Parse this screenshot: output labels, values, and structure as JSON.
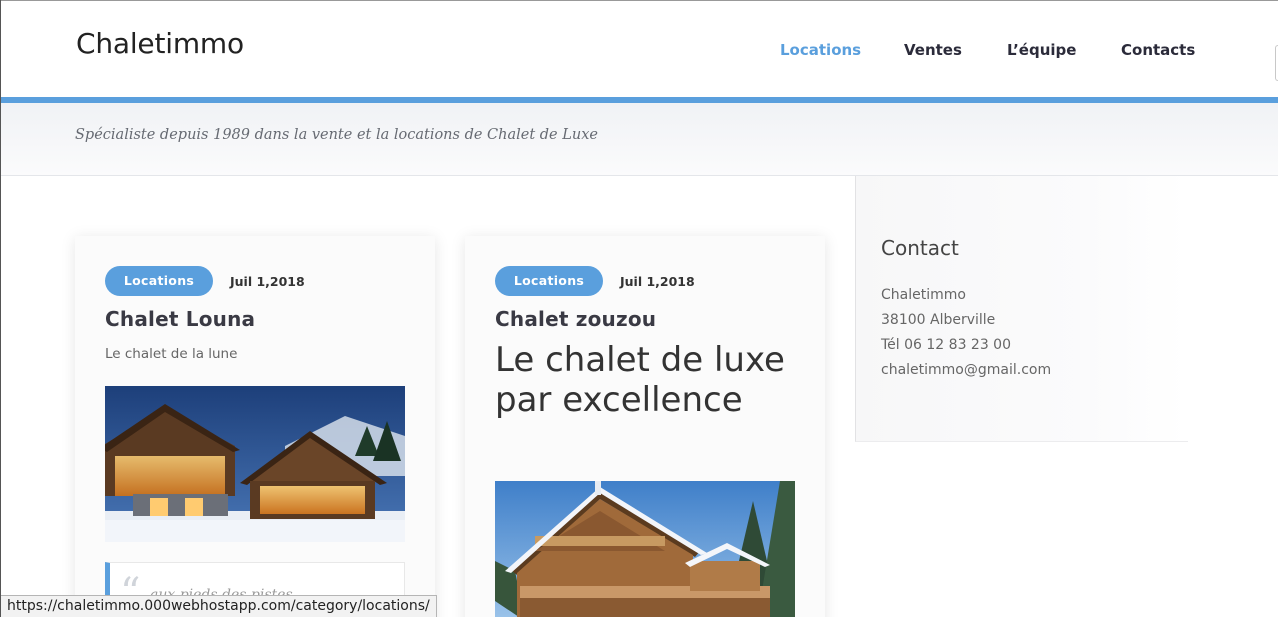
{
  "brand": "Chaletimmo",
  "nav": {
    "items": [
      {
        "label": "Locations",
        "active": true
      },
      {
        "label": "Ventes",
        "active": false
      },
      {
        "label": "L’équipe",
        "active": false
      },
      {
        "label": "Contacts",
        "active": false
      }
    ]
  },
  "tagline": "Spécialiste depuis 1989 dans la vente et la locations de Chalet de Luxe",
  "colors": {
    "accent": "#5a9fdd",
    "nav_text": "#2b2b3a",
    "text": "#333333"
  },
  "posts": [
    {
      "category": "Locations",
      "date": "Juil 1,2018",
      "title": "Chalet Louna",
      "excerpt": "Le chalet de la lune",
      "image": "chalet-night-snow-photo",
      "quote": "aux pieds des pistes",
      "quote_icon": "quote-icon"
    },
    {
      "category": "Locations",
      "date": "Juil 1,2018",
      "title": "Chalet zouzou",
      "heading": "Le chalet de luxe par excellence",
      "image": "chalet-day-snow-photo"
    }
  ],
  "sidebar": {
    "title": "Contact",
    "lines": [
      "Chaletimmo",
      "38100 Alberville",
      "Tél 06 12 83 23 00",
      "chaletimmo@gmail.com"
    ]
  },
  "status_url": "https://chaletimmo.000webhostapp.com/category/locations/"
}
